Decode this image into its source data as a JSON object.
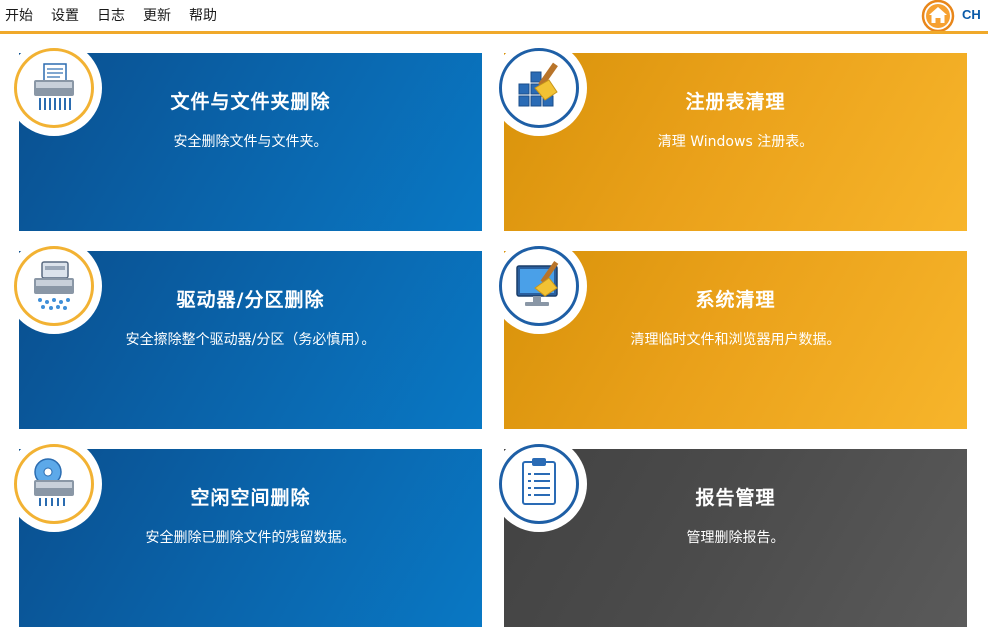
{
  "menu": {
    "items": [
      "开始",
      "设置",
      "日志",
      "更新",
      "帮助"
    ]
  },
  "header": {
    "lang_label": "CH"
  },
  "tiles": [
    {
      "title": "文件与文件夹删除",
      "desc": "安全删除文件与文件夹。",
      "icon": "file-shredder-icon"
    },
    {
      "title": "注册表清理",
      "desc": "清理 Windows 注册表。",
      "icon": "registry-broom-icon"
    },
    {
      "title": "驱动器/分区删除",
      "desc": "安全擦除整个驱动器/分区（务必慎用）。",
      "icon": "drive-shredder-icon"
    },
    {
      "title": "系统清理",
      "desc": "清理临时文件和浏览器用户数据。",
      "icon": "monitor-broom-icon"
    },
    {
      "title": "空闲空间删除",
      "desc": "安全删除已删除文件的残留数据。",
      "icon": "disc-shredder-icon"
    },
    {
      "title": "报告管理",
      "desc": "管理删除报告。",
      "icon": "clipboard-report-icon"
    }
  ],
  "colors": {
    "accent": "#f0a92a",
    "blue": "#0a62a8",
    "orange": "#eaa11a",
    "gray": "#4b4b4b"
  }
}
